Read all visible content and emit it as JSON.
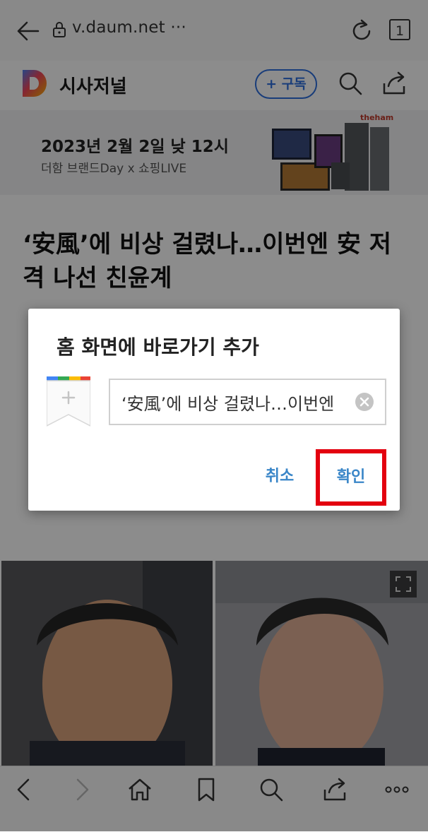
{
  "browser": {
    "url": "v.daum.net ···",
    "tab_count": "1"
  },
  "site": {
    "name": "시사저널",
    "subscribe_label": "+ 구독"
  },
  "ad": {
    "title": "2023년 2월 2일 낮 12시",
    "subtitle": "더함 브랜드Day x 쇼핑LIVE",
    "brand": "theham"
  },
  "article": {
    "headline": "‘安風’에 비상 걸렸나…이번엔 安 저격 나선 친윤계"
  },
  "dialog": {
    "title": "홈 화면에 바로가기 추가",
    "shortcut_name": "‘安風’에 비상 걸렸나…이번엔",
    "cancel_label": "취소",
    "confirm_label": "확인"
  },
  "icons": [
    "back-arrow-icon",
    "lock-icon",
    "reload-icon",
    "tabs-icon",
    "daum-d-logo",
    "search-icon",
    "share-icon",
    "expand-icon",
    "nav-back-icon",
    "nav-forward-icon",
    "home-icon",
    "bookmark-icon",
    "share-icon",
    "more-icon",
    "bookmark-plus-icon",
    "clear-icon"
  ],
  "colors": {
    "accent": "#2f6fde",
    "dialog_button": "#3a86c8",
    "highlight": "#e3000f"
  }
}
